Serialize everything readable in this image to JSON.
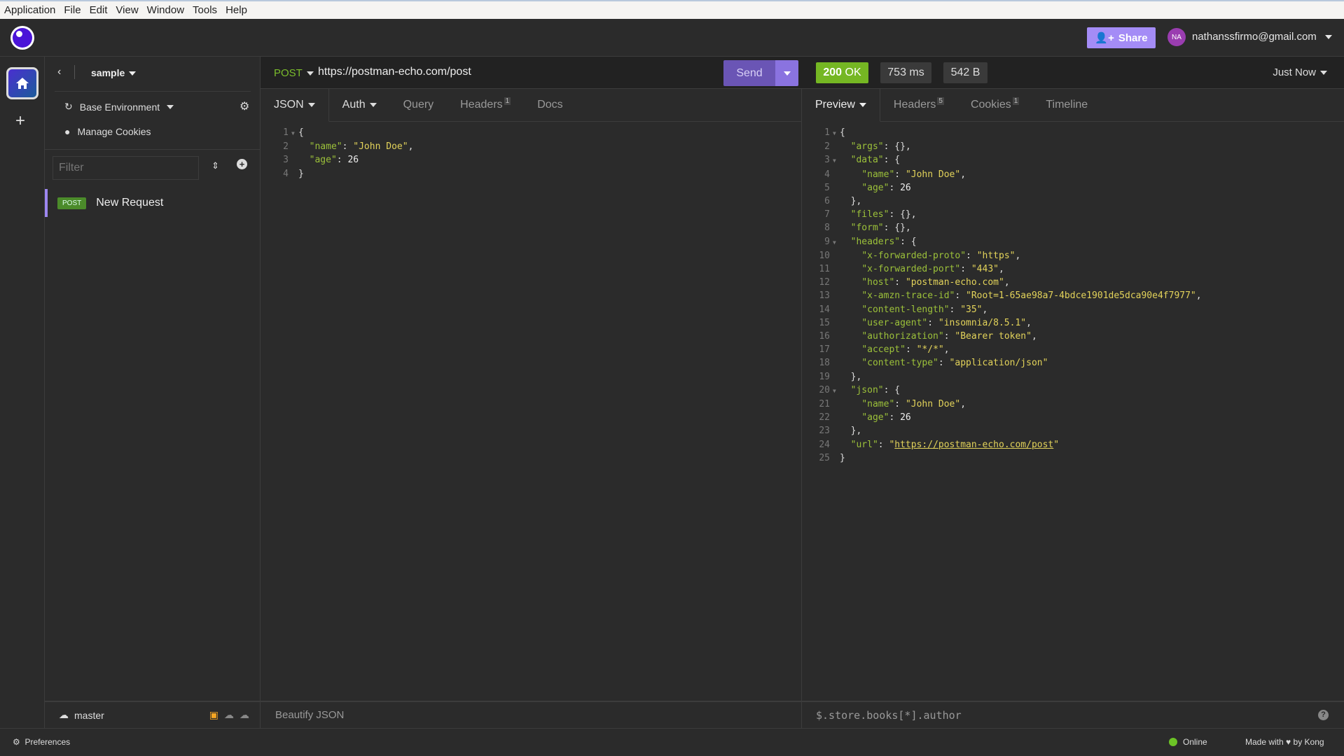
{
  "menu": [
    "Application",
    "File",
    "Edit",
    "View",
    "Window",
    "Tools",
    "Help"
  ],
  "header": {
    "share_label": "Share",
    "avatar_initials": "NA",
    "email": "nathanssfirmo@gmail.com"
  },
  "sidebar": {
    "project": "sample",
    "environment": "Base Environment",
    "manage_cookies": "Manage Cookies",
    "filter_placeholder": "Filter",
    "requests": [
      {
        "method": "POST",
        "name": "New Request"
      }
    ],
    "branch": "master"
  },
  "request": {
    "method": "POST",
    "url": "https://postman-echo.com/post",
    "send_label": "Send",
    "tabs": [
      {
        "label": "JSON"
      },
      {
        "label": "Auth"
      },
      {
        "label": "Query"
      },
      {
        "label": "Headers",
        "count": "1"
      },
      {
        "label": "Docs"
      }
    ],
    "body_lines": [
      {
        "fold": true,
        "tokens": [
          [
            "p",
            "{"
          ]
        ]
      },
      {
        "tokens": [
          [
            "p",
            "  "
          ],
          [
            "k",
            "\"name\""
          ],
          [
            "p",
            ": "
          ],
          [
            "s",
            "\"John Doe\""
          ],
          [
            "p",
            ","
          ]
        ]
      },
      {
        "tokens": [
          [
            "p",
            "  "
          ],
          [
            "k",
            "\"age\""
          ],
          [
            "p",
            ": "
          ],
          [
            "n",
            "26"
          ]
        ]
      },
      {
        "tokens": [
          [
            "p",
            "}"
          ]
        ]
      }
    ],
    "footer_action": "Beautify JSON"
  },
  "response": {
    "status": "200",
    "status_text": "OK",
    "time": "753 ms",
    "size": "542 B",
    "history": "Just Now",
    "colors": {
      "status_ok": "#75b723",
      "accent": "#a48cf6"
    },
    "tabs": [
      {
        "label": "Preview"
      },
      {
        "label": "Headers",
        "count": "5"
      },
      {
        "label": "Cookies",
        "count": "1"
      },
      {
        "label": "Timeline"
      }
    ],
    "filter_placeholder": "$.store.books[*].author",
    "lines": [
      {
        "fold": true,
        "tokens": [
          [
            "p",
            "{"
          ]
        ]
      },
      {
        "tokens": [
          [
            "p",
            "  "
          ],
          [
            "k",
            "\"args\""
          ],
          [
            "p",
            ": {},"
          ]
        ]
      },
      {
        "fold": true,
        "tokens": [
          [
            "p",
            "  "
          ],
          [
            "k",
            "\"data\""
          ],
          [
            "p",
            ": {"
          ]
        ]
      },
      {
        "tokens": [
          [
            "p",
            "    "
          ],
          [
            "k",
            "\"name\""
          ],
          [
            "p",
            ": "
          ],
          [
            "s",
            "\"John Doe\""
          ],
          [
            "p",
            ","
          ]
        ]
      },
      {
        "tokens": [
          [
            "p",
            "    "
          ],
          [
            "k",
            "\"age\""
          ],
          [
            "p",
            ": "
          ],
          [
            "n",
            "26"
          ]
        ]
      },
      {
        "tokens": [
          [
            "p",
            "  },"
          ]
        ]
      },
      {
        "tokens": [
          [
            "p",
            "  "
          ],
          [
            "k",
            "\"files\""
          ],
          [
            "p",
            ": {},"
          ]
        ]
      },
      {
        "tokens": [
          [
            "p",
            "  "
          ],
          [
            "k",
            "\"form\""
          ],
          [
            "p",
            ": {},"
          ]
        ]
      },
      {
        "fold": true,
        "tokens": [
          [
            "p",
            "  "
          ],
          [
            "k",
            "\"headers\""
          ],
          [
            "p",
            ": {"
          ]
        ]
      },
      {
        "tokens": [
          [
            "p",
            "    "
          ],
          [
            "k",
            "\"x-forwarded-proto\""
          ],
          [
            "p",
            ": "
          ],
          [
            "s",
            "\"https\""
          ],
          [
            "p",
            ","
          ]
        ]
      },
      {
        "tokens": [
          [
            "p",
            "    "
          ],
          [
            "k",
            "\"x-forwarded-port\""
          ],
          [
            "p",
            ": "
          ],
          [
            "s",
            "\"443\""
          ],
          [
            "p",
            ","
          ]
        ]
      },
      {
        "tokens": [
          [
            "p",
            "    "
          ],
          [
            "k",
            "\"host\""
          ],
          [
            "p",
            ": "
          ],
          [
            "s",
            "\"postman-echo.com\""
          ],
          [
            "p",
            ","
          ]
        ]
      },
      {
        "tokens": [
          [
            "p",
            "    "
          ],
          [
            "k",
            "\"x-amzn-trace-id\""
          ],
          [
            "p",
            ": "
          ],
          [
            "s",
            "\"Root=1-65ae98a7-4bdce1901de5dca90e4f7977\""
          ],
          [
            "p",
            ","
          ]
        ]
      },
      {
        "tokens": [
          [
            "p",
            "    "
          ],
          [
            "k",
            "\"content-length\""
          ],
          [
            "p",
            ": "
          ],
          [
            "s",
            "\"35\""
          ],
          [
            "p",
            ","
          ]
        ]
      },
      {
        "tokens": [
          [
            "p",
            "    "
          ],
          [
            "k",
            "\"user-agent\""
          ],
          [
            "p",
            ": "
          ],
          [
            "s",
            "\"insomnia/8.5.1\""
          ],
          [
            "p",
            ","
          ]
        ]
      },
      {
        "tokens": [
          [
            "p",
            "    "
          ],
          [
            "k",
            "\"authorization\""
          ],
          [
            "p",
            ": "
          ],
          [
            "s",
            "\"Bearer token\""
          ],
          [
            "p",
            ","
          ]
        ]
      },
      {
        "tokens": [
          [
            "p",
            "    "
          ],
          [
            "k",
            "\"accept\""
          ],
          [
            "p",
            ": "
          ],
          [
            "s",
            "\"*/*\""
          ],
          [
            "p",
            ","
          ]
        ]
      },
      {
        "tokens": [
          [
            "p",
            "    "
          ],
          [
            "k",
            "\"content-type\""
          ],
          [
            "p",
            ": "
          ],
          [
            "s",
            "\"application/json\""
          ]
        ]
      },
      {
        "tokens": [
          [
            "p",
            "  },"
          ]
        ]
      },
      {
        "fold": true,
        "tokens": [
          [
            "p",
            "  "
          ],
          [
            "k",
            "\"json\""
          ],
          [
            "p",
            ": {"
          ]
        ]
      },
      {
        "tokens": [
          [
            "p",
            "    "
          ],
          [
            "k",
            "\"name\""
          ],
          [
            "p",
            ": "
          ],
          [
            "s",
            "\"John Doe\""
          ],
          [
            "p",
            ","
          ]
        ]
      },
      {
        "tokens": [
          [
            "p",
            "    "
          ],
          [
            "k",
            "\"age\""
          ],
          [
            "p",
            ": "
          ],
          [
            "n",
            "26"
          ]
        ]
      },
      {
        "tokens": [
          [
            "p",
            "  },"
          ]
        ]
      },
      {
        "tokens": [
          [
            "p",
            "  "
          ],
          [
            "k",
            "\"url\""
          ],
          [
            "p",
            ": "
          ],
          [
            "s",
            "\""
          ],
          [
            "u",
            "https://postman-echo.com/post"
          ],
          [
            "s",
            "\""
          ]
        ]
      },
      {
        "tokens": [
          [
            "p",
            "}"
          ]
        ]
      }
    ]
  },
  "statusbar": {
    "preferences": "Preferences",
    "online": "Online",
    "made_with": "Made with",
    "by": "by Kong"
  }
}
